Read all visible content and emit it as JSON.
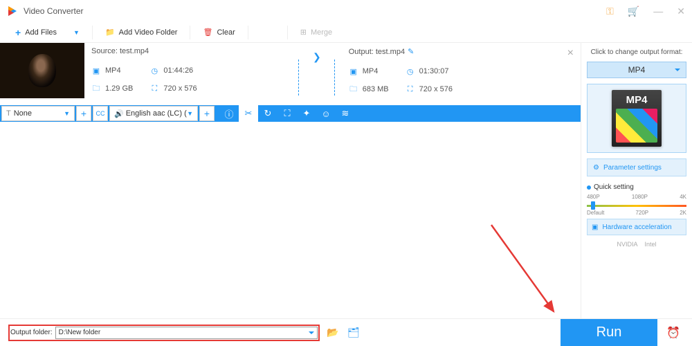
{
  "title": "Video Converter",
  "toolbar": {
    "add_files": "Add Files",
    "add_folder": "Add Video Folder",
    "clear": "Clear",
    "merge": "Merge"
  },
  "item": {
    "source_label": "Source:",
    "source_name": "test.mp4",
    "output_label": "Output:",
    "output_name": "test.mp4",
    "src": {
      "format": "MP4",
      "duration": "01:44:26",
      "size": "1.29 GB",
      "res": "720 x 576"
    },
    "out": {
      "format": "MP4",
      "duration": "01:30:07",
      "size": "683 MB",
      "res": "720 x 576"
    },
    "sub": "None",
    "audio": "English aac (LC) (mp"
  },
  "side": {
    "click_label": "Click to change output format:",
    "format": "MP4",
    "param": "Parameter settings",
    "quick": "Quick setting",
    "ticks_top": [
      "480P",
      "1080P",
      "4K"
    ],
    "ticks_bot": [
      "Default",
      "720P",
      "2K"
    ],
    "hw": "Hardware acceleration",
    "nvidia": "NVIDIA",
    "intel": "Intel"
  },
  "footer": {
    "label": "Output folder:",
    "value": "D:\\New folder"
  },
  "run": "Run"
}
